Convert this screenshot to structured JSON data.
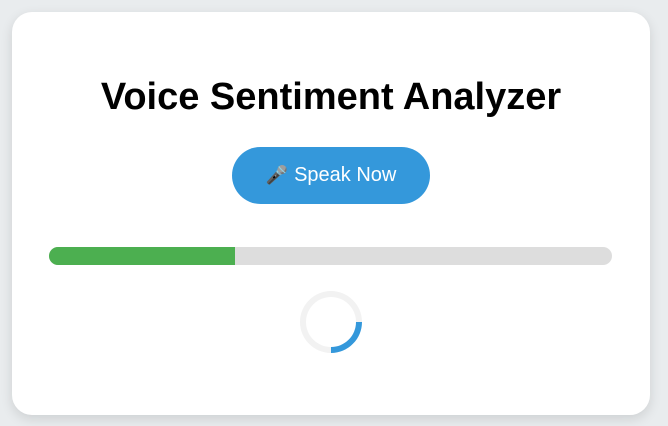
{
  "title": "Voice Sentiment Analyzer",
  "speak_button": {
    "icon": "microphone-icon",
    "icon_glyph": "🎤",
    "label": "Speak Now"
  },
  "progress": {
    "percent": 33
  },
  "colors": {
    "accent": "#3498db",
    "progress": "#4caf50",
    "track": "#dddddd"
  }
}
